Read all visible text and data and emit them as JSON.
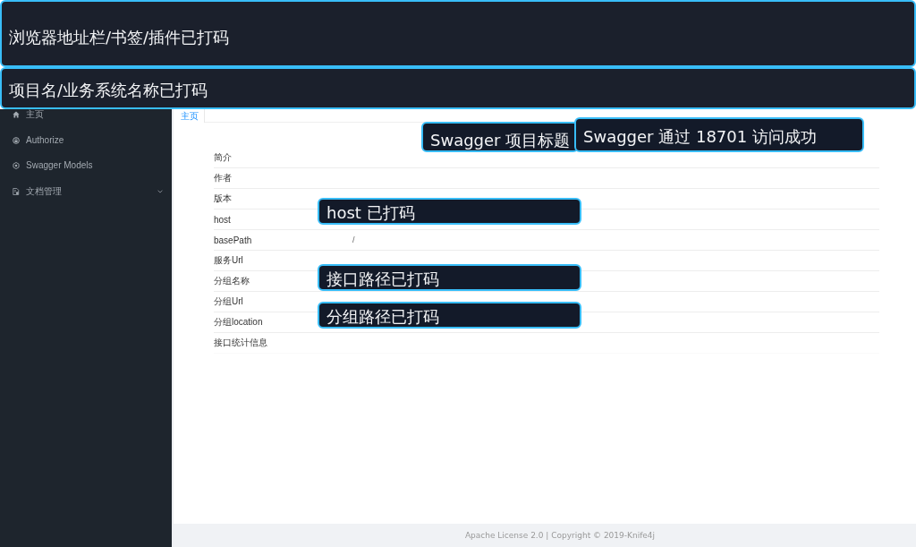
{
  "redaction_banners": [
    {
      "text": "浏览器地址栏/书签/插件已打码"
    },
    {
      "text": "项目名/业务系统名称已打码"
    }
  ],
  "sidebar": {
    "items": [
      {
        "label": "主页",
        "kind": "link",
        "selected": false
      },
      {
        "label": "Authorize",
        "kind": "link",
        "selected": false
      },
      {
        "label": "Swagger Models",
        "kind": "link",
        "selected": false
      },
      {
        "label": "文档管理",
        "kind": "submenu",
        "selected": false,
        "expanded": false
      }
    ]
  },
  "tabs": [
    {
      "label": "主页",
      "selected": true
    }
  ],
  "info_table": {
    "rows": [
      {
        "label": "简介"
      },
      {
        "label": "作者"
      },
      {
        "label": "版本"
      },
      {
        "label": "host"
      },
      {
        "label": "basePath",
        "value": "/"
      },
      {
        "label": "服务Url"
      },
      {
        "label": "分组名称"
      },
      {
        "label": "分组Url"
      },
      {
        "label": "分组location"
      },
      {
        "label": "接口统计信息"
      }
    ]
  },
  "overlay_notes": [
    {
      "text": "Swagger 项目标题"
    },
    {
      "text": "Swagger 通过 18701 访问成功"
    },
    {
      "text": "host 已打码"
    },
    {
      "text": "接口路径已打码"
    },
    {
      "text": "分组路径已打码"
    }
  ],
  "footer": {
    "text": "Apache License 2.0 | Copyright © 2019-Knife4j"
  }
}
